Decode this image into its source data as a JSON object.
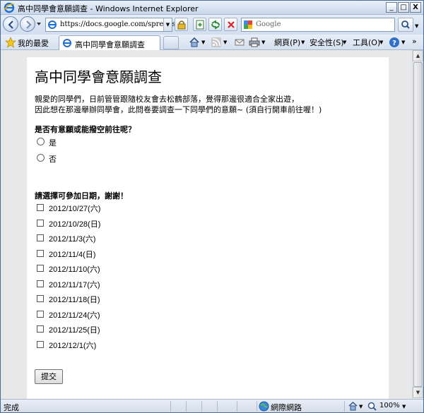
{
  "window": {
    "title": "高中同學會意願調查 - Windows Internet Explorer",
    "controls": {
      "minimize": "_",
      "maximize": "□",
      "close": "X"
    }
  },
  "address_bar": {
    "url": "https://docs.google.com/spreadshe",
    "search_placeholder": "Google"
  },
  "favorites_bar": {
    "favorites_label": "我的最愛",
    "tab_title": "高中同學會意願調查"
  },
  "command_bar": {
    "page_menu": "網頁(P)",
    "safety_menu": "安全性(S)",
    "tools_menu": "工具(O)"
  },
  "form": {
    "title": "高中同學會意願調查",
    "description_line1": "親愛的同學們，日前管管跟隨校友會去松鶴部落，覺得那邊很適合全家出遊，",
    "description_line2": "因此想在那邊舉辦同學會，此問卷要調查一下同學們的意願~ (須自行開車前往喔！)",
    "q1": {
      "title": "是否有意願或能撥空前往呢？",
      "options": [
        "是",
        "否"
      ]
    },
    "q2": {
      "title": "請選擇可參加日期，謝謝！",
      "options": [
        "2012/10/27(六)",
        "2012/10/28(日)",
        "2012/11/3(六)",
        "2012/11/4(日)",
        "2012/11/10(六)",
        "2012/11/17(六)",
        "2012/11/18(日)",
        "2012/11/24(六)",
        "2012/11/25(日)",
        "2012/12/1(六)"
      ]
    },
    "submit_label": "提交"
  },
  "status_bar": {
    "status": "完成",
    "zone": "網際網路",
    "zoom": "100%"
  }
}
